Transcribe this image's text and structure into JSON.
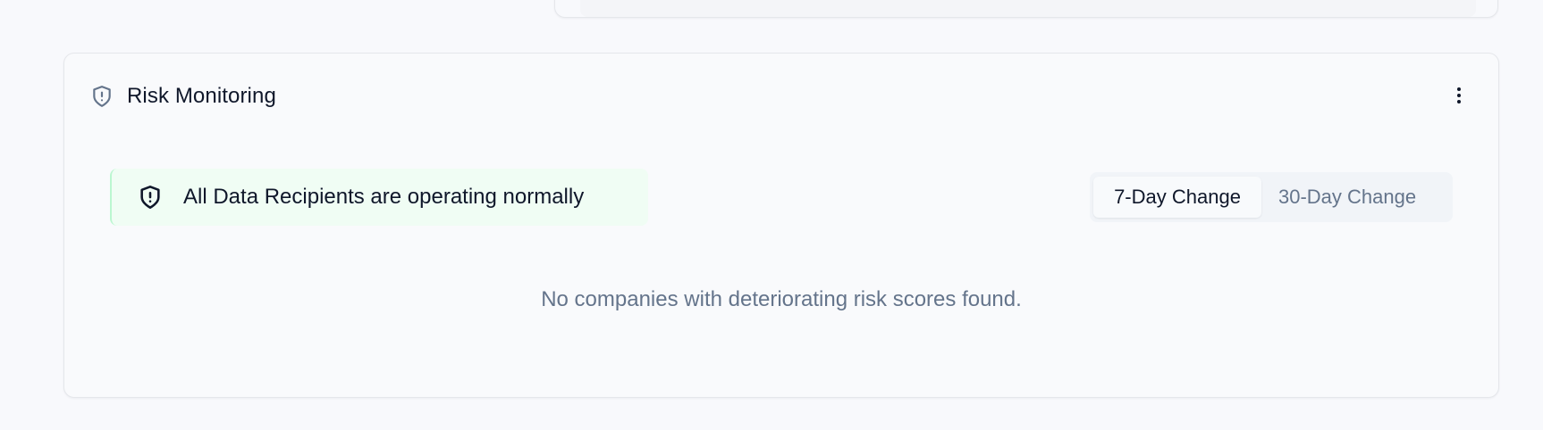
{
  "risk_monitoring": {
    "title": "Risk Monitoring",
    "header_icon": "shield-alert-icon",
    "menu_icon": "more-vertical-icon",
    "status": {
      "icon": "shield-alert-icon",
      "text": "All Data Recipients are operating normally",
      "color": "#f0fdf4"
    },
    "period_toggle": {
      "options": [
        "7-Day Change",
        "30-Day Change"
      ],
      "selected": "7-Day Change"
    },
    "empty_message": "No companies with deteriorating risk scores found."
  },
  "colors": {
    "background": "#f8f9fc",
    "text_primary": "#0f172a",
    "text_muted": "#64748b",
    "success_bg": "#f0fdf4",
    "success_border": "#bbf7d0",
    "toggle_bg": "#f1f4f8"
  }
}
